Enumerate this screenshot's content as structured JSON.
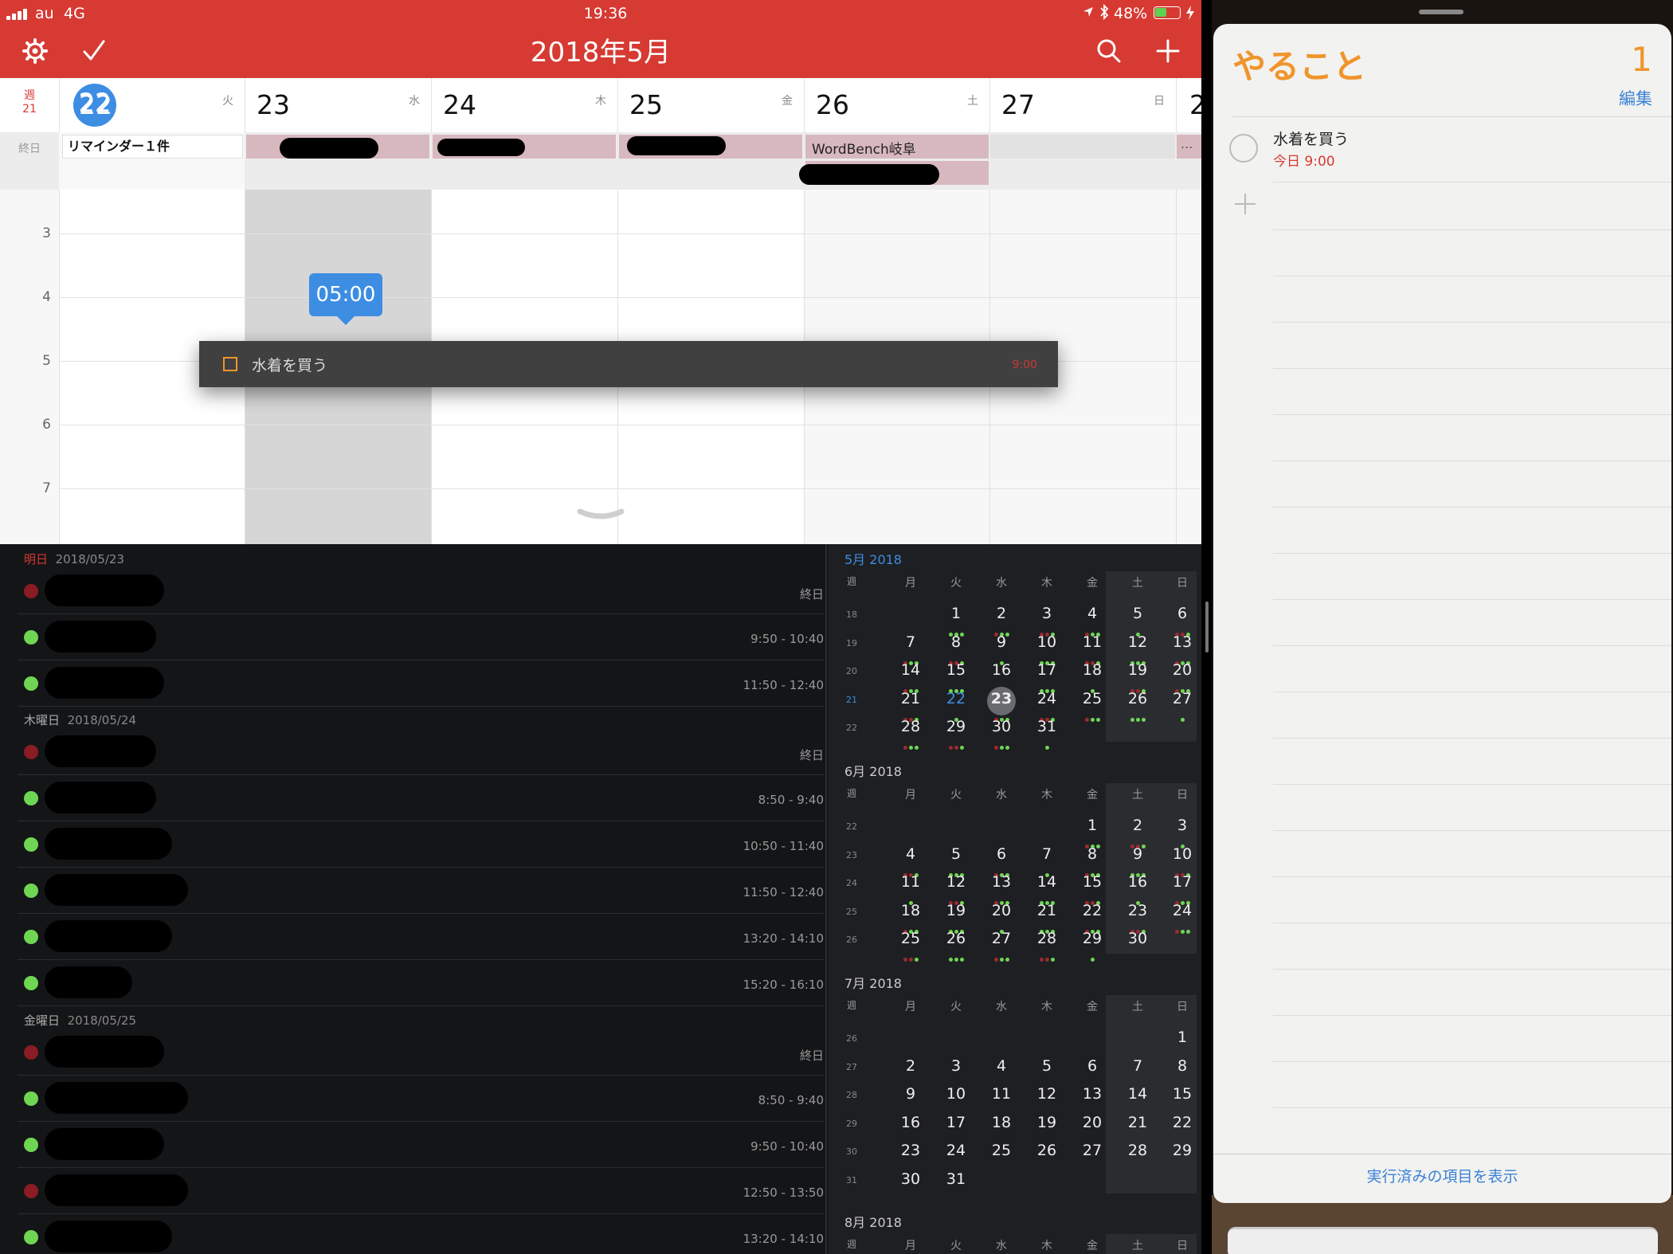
{
  "status_bar": {
    "carrier": "au",
    "network": "4G",
    "time": "19:36",
    "battery": "48%"
  },
  "toolbar": {
    "title": "2018年5月",
    "settings_icon": "gear-icon",
    "check_icon": "checkmark-icon",
    "search_icon": "search-icon",
    "add_icon": "plus-icon"
  },
  "week": {
    "week_label": "週",
    "week_number": "21",
    "days": [
      {
        "num": "22",
        "dow": "火"
      },
      {
        "num": "23",
        "dow": "水"
      },
      {
        "num": "24",
        "dow": "木"
      },
      {
        "num": "25",
        "dow": "金"
      },
      {
        "num": "26",
        "dow": "土"
      },
      {
        "num": "27",
        "dow": "日"
      },
      {
        "num": "2",
        "dow": ""
      }
    ]
  },
  "allday": {
    "label": "終日",
    "reminder_count": "リマインダー１件",
    "event_26": "WordBench岐阜",
    "more": "..."
  },
  "timeline": {
    "hours": [
      "3",
      "4",
      "5",
      "6",
      "7"
    ],
    "drag_time": "05:00",
    "drag_item": "水着を買う",
    "drag_item_time": "9:00"
  },
  "list": {
    "sections": [
      {
        "day": "明日",
        "date": "2018/05/23",
        "events": [
          {
            "time": "終日",
            "color": "#8b1c24"
          },
          {
            "time": "9:50 - 10:40",
            "color": "#6ed653"
          },
          {
            "time": "11:50 - 12:40",
            "color": "#6ed653"
          }
        ]
      },
      {
        "day": "木曜日",
        "date": "2018/05/24",
        "events": [
          {
            "time": "終日",
            "color": "#8b1c24"
          },
          {
            "time": "8:50 - 9:40",
            "color": "#6ed653"
          },
          {
            "time": "10:50 - 11:40",
            "color": "#6ed653"
          },
          {
            "time": "11:50 - 12:40",
            "color": "#6ed653"
          },
          {
            "time": "13:20 - 14:10",
            "color": "#6ed653"
          },
          {
            "time": "15:20 - 16:10",
            "color": "#6ed653"
          }
        ]
      },
      {
        "day": "金曜日",
        "date": "2018/05/25",
        "events": [
          {
            "time": "終日",
            "color": "#8b1c24"
          },
          {
            "time": "8:50 - 9:40",
            "color": "#6ed653"
          },
          {
            "time": "9:50 - 10:40",
            "color": "#6ed653"
          },
          {
            "time": "12:50 - 13:50",
            "color": "#8b1c24"
          },
          {
            "time": "13:20 - 14:10",
            "color": "#6ed653"
          }
        ]
      }
    ]
  },
  "mini_calendar": {
    "weekdays": [
      "週",
      "月",
      "火",
      "水",
      "木",
      "金",
      "土",
      "日"
    ],
    "months": [
      {
        "title": "5月 2018",
        "weeks": [
          {
            "wk": "18",
            "days": [
              "",
              "1",
              "2",
              "3",
              "4",
              "5",
              "6"
            ]
          },
          {
            "wk": "19",
            "days": [
              "7",
              "8",
              "9",
              "10",
              "11",
              "12",
              "13"
            ]
          },
          {
            "wk": "20",
            "days": [
              "14",
              "15",
              "16",
              "17",
              "18",
              "19",
              "20"
            ]
          },
          {
            "wk": "21",
            "days": [
              "21",
              "22",
              "23",
              "24",
              "25",
              "26",
              "27"
            ]
          },
          {
            "wk": "22",
            "days": [
              "28",
              "29",
              "30",
              "31",
              "",
              "",
              ""
            ]
          }
        ]
      },
      {
        "title": "6月 2018",
        "weeks": [
          {
            "wk": "22",
            "days": [
              "",
              "",
              "",
              "",
              "1",
              "2",
              "3"
            ]
          },
          {
            "wk": "23",
            "days": [
              "4",
              "5",
              "6",
              "7",
              "8",
              "9",
              "10"
            ]
          },
          {
            "wk": "24",
            "days": [
              "11",
              "12",
              "13",
              "14",
              "15",
              "16",
              "17"
            ]
          },
          {
            "wk": "25",
            "days": [
              "18",
              "19",
              "20",
              "21",
              "22",
              "23",
              "24"
            ]
          },
          {
            "wk": "26",
            "days": [
              "25",
              "26",
              "27",
              "28",
              "29",
              "30",
              ""
            ]
          }
        ]
      },
      {
        "title": "7月 2018",
        "weeks": [
          {
            "wk": "26",
            "days": [
              "",
              "",
              "",
              "",
              "",
              "",
              "1"
            ]
          },
          {
            "wk": "27",
            "days": [
              "2",
              "3",
              "4",
              "5",
              "6",
              "7",
              "8"
            ]
          },
          {
            "wk": "28",
            "days": [
              "9",
              "10",
              "11",
              "12",
              "13",
              "14",
              "15"
            ]
          },
          {
            "wk": "29",
            "days": [
              "16",
              "17",
              "18",
              "19",
              "20",
              "21",
              "22"
            ]
          },
          {
            "wk": "30",
            "days": [
              "23",
              "24",
              "25",
              "26",
              "27",
              "28",
              "29"
            ]
          },
          {
            "wk": "31",
            "days": [
              "30",
              "31",
              "",
              "",
              "",
              "",
              ""
            ]
          }
        ]
      },
      {
        "title": "8月 2018",
        "weeks": []
      }
    ]
  },
  "reminders": {
    "list_title": "やること",
    "count": "1",
    "edit": "編集",
    "items": [
      {
        "title": "水着を買う",
        "due": "今日 9:00"
      }
    ],
    "show_completed": "実行済みの項目を表示"
  },
  "colors": {
    "accent_red": "#d63a33",
    "today_blue": "#3d8de3",
    "reminders_orange": "#f0952a",
    "ios_blue": "#3b82d6"
  }
}
